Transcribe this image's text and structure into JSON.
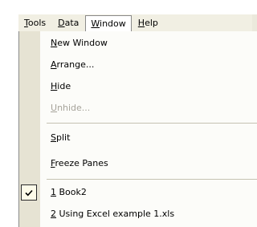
{
  "menubar": {
    "items": [
      {
        "access_key": "T",
        "rest": "ools"
      },
      {
        "access_key": "D",
        "rest": "ata"
      },
      {
        "access_key": "W",
        "rest": "indow"
      },
      {
        "access_key": "H",
        "rest": "elp"
      }
    ],
    "active_item": "Window"
  },
  "menu": {
    "items": [
      {
        "access_key": "N",
        "rest": "ew Window",
        "enabled": true
      },
      {
        "access_key": "A",
        "rest": "rrange...",
        "enabled": true
      },
      {
        "access_key": "H",
        "rest": "ide",
        "enabled": true
      },
      {
        "access_key": "U",
        "rest": "nhide...",
        "enabled": false
      },
      {
        "access_key": "S",
        "rest": "plit",
        "enabled": true
      },
      {
        "access_key": "F",
        "rest": "reeze Panes",
        "enabled": true
      },
      {
        "access_key": "1",
        "rest": " Book2",
        "enabled": true,
        "checked": true
      },
      {
        "access_key": "2",
        "rest": " Using Excel example 1.xls",
        "enabled": true
      }
    ]
  },
  "colors": {
    "menubar_background": "#f1efe3",
    "gutter_background": "#e6e3d3",
    "menu_background": "#fcfcf9",
    "disabled_text": "#a6a39a",
    "check_background": "#fdfbe9"
  },
  "icons": {
    "checked_item": "checkmark-icon"
  }
}
